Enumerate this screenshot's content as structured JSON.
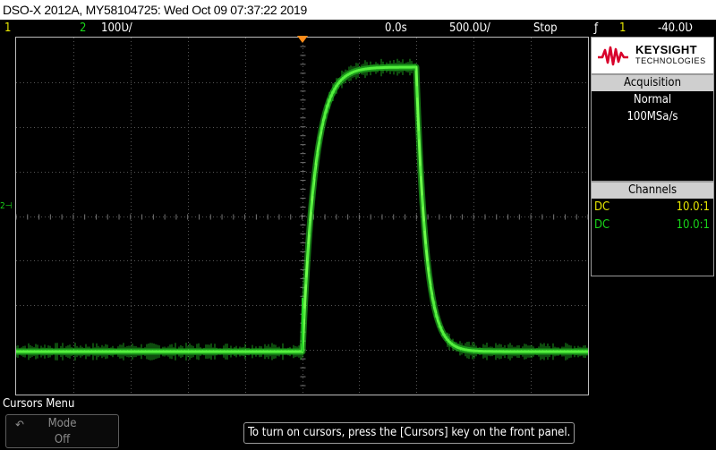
{
  "title_bar": {
    "text": "DSO-X 2012A, MY58104725: Wed Oct 09 07:37:22 2019"
  },
  "status_bar": {
    "ch1_number": "1",
    "ch2_number": "2",
    "ch2_scale": "100Ʋ/",
    "time_delay": "0.0s",
    "time_base": "500.0Ʋ/",
    "run_state": "Stop",
    "trigger_symbol": "ƒ",
    "trigger_source": "1",
    "trigger_level": "-40.0Ʋ"
  },
  "ground_marker": {
    "label": "2⊣"
  },
  "logo": {
    "line1": "KEYSIGHT",
    "line2": "TECHNOLOGIES",
    "accent_color": "#d8002b"
  },
  "acquisition": {
    "title": "Acquisition",
    "mode": "Normal",
    "sample_rate": "100MSa/s"
  },
  "channels": {
    "title": "Channels",
    "rows": [
      {
        "coupling": "DC",
        "probe": "10.0:1",
        "color": "#e6e600"
      },
      {
        "coupling": "DC",
        "probe": "10.0:1",
        "color": "#19d419"
      }
    ]
  },
  "softkey_menu": {
    "title": "Cursors Menu",
    "mode_button": {
      "icon": "rotate-knob-icon",
      "label": "Mode",
      "value": "Off"
    }
  },
  "hint": {
    "text": "To turn on cursors, press the [Cursors] key on the front panel."
  },
  "colors": {
    "ch1": "#e6e600",
    "ch2": "#19d419",
    "trace": "#26d626",
    "trigger_marker": "#ff8c1a"
  }
}
